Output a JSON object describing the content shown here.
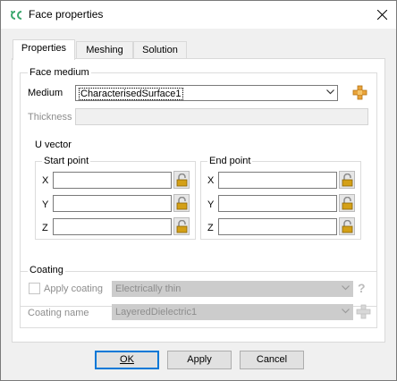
{
  "window": {
    "title": "Face properties"
  },
  "tabs": [
    {
      "label": "Properties",
      "active": true
    },
    {
      "label": "Meshing",
      "active": false
    },
    {
      "label": "Solution",
      "active": false
    }
  ],
  "face_medium": {
    "group_label": "Face medium",
    "medium_label": "Medium",
    "medium_value": "CharacterisedSurface1",
    "thickness_label": "Thickness",
    "thickness_value": ""
  },
  "u_vector": {
    "label": "U vector",
    "start_point": {
      "label": "Start point",
      "x_label": "X",
      "y_label": "Y",
      "z_label": "Z",
      "x": "",
      "y": "",
      "z": ""
    },
    "end_point": {
      "label": "End point",
      "x_label": "X",
      "y_label": "Y",
      "z_label": "Z",
      "x": "",
      "y": "",
      "z": ""
    }
  },
  "coating": {
    "group_label": "Coating",
    "apply_label": "Apply coating",
    "apply_checked": false,
    "apply_value": "Electrically thin",
    "name_label": "Coating name",
    "name_value": "LayeredDielectric1",
    "help_glyph": "?"
  },
  "buttons": {
    "ok": "OK",
    "apply": "Apply",
    "cancel": "Cancel"
  },
  "colors": {
    "accent": "#0078d7",
    "lock": "#d4a017",
    "add": "#e8a33a",
    "icon_green": "#3aa76d"
  }
}
